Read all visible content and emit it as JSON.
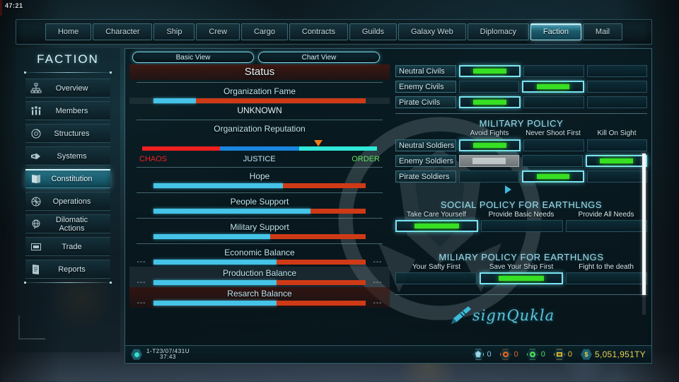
{
  "hud": {
    "top_timer": "47:21"
  },
  "topnav": {
    "tabs": [
      {
        "label": "Home",
        "active": false
      },
      {
        "label": "Character",
        "active": false
      },
      {
        "label": "Ship",
        "active": false
      },
      {
        "label": "Crew",
        "active": false
      },
      {
        "label": "Cargo",
        "active": false
      },
      {
        "label": "Contracts",
        "active": false
      },
      {
        "label": "Guilds",
        "active": false
      },
      {
        "label": "Galaxy Web",
        "active": false
      },
      {
        "label": "Diplomacy",
        "active": false
      },
      {
        "label": "Faction",
        "active": true
      },
      {
        "label": "Mail",
        "active": false
      }
    ]
  },
  "sidebar": {
    "title": "FACTION",
    "items": [
      {
        "label": "Overview",
        "icon": "org-chart-icon",
        "active": false
      },
      {
        "label": "Members",
        "icon": "people-group-icon",
        "active": false
      },
      {
        "label": "Structures",
        "icon": "structure-icon",
        "active": false
      },
      {
        "label": "Systems",
        "icon": "ship-icon",
        "active": false
      },
      {
        "label": "Constitution",
        "icon": "book-icon",
        "active": true
      },
      {
        "label": "Operations",
        "icon": "operations-icon",
        "active": false
      },
      {
        "label": "Dilomatic Actions",
        "icon": "globe-icon",
        "active": false
      },
      {
        "label": "Trade",
        "icon": "trade-icon",
        "active": false
      },
      {
        "label": "Reports",
        "icon": "report-icon",
        "active": false
      }
    ]
  },
  "panel": {
    "view_tabs": [
      {
        "label": "Basic View",
        "active": true
      },
      {
        "label": "Chart View",
        "active": false
      }
    ],
    "status": {
      "title": "Status",
      "fame": {
        "label": "Organization Fame",
        "blue_pct": 20,
        "red_pct": 80,
        "value_text": "UNKNOWN"
      },
      "reputation": {
        "label": "Organization Reputation",
        "left_label": "CHAOS",
        "mid_label": "JUSTICE",
        "right_label": "ORDER",
        "chaos_pct": 33,
        "justice_pct": 34,
        "order_pct": 33,
        "marker_pct": 75,
        "left_color": "#ef2020",
        "mid_color": "#1a86e0",
        "right_color": "#2fe8d8",
        "marker_color": "#f07a16"
      },
      "bars": [
        {
          "label": "Hope",
          "blue_pct": 61,
          "red_pct": 39,
          "left_dots": "",
          "right_dots": "",
          "band": "none"
        },
        {
          "label": "People Support",
          "blue_pct": 74,
          "red_pct": 26,
          "left_dots": "",
          "right_dots": "",
          "band": "none"
        },
        {
          "label": "Military Support",
          "blue_pct": 55,
          "red_pct": 45,
          "left_dots": "",
          "right_dots": "",
          "band": "none"
        },
        {
          "label": "Economic Balance",
          "blue_pct": 58,
          "red_pct": 42,
          "left_dots": "---",
          "right_dots": "---",
          "band": "none"
        },
        {
          "label": "Production Balance",
          "blue_pct": 58,
          "red_pct": 42,
          "left_dots": "---",
          "right_dots": "---",
          "band": "grey"
        },
        {
          "label": "Resarch Balance",
          "blue_pct": 58,
          "red_pct": 42,
          "left_dots": "---",
          "right_dots": "---",
          "band": "red"
        }
      ]
    },
    "civils": {
      "rows": [
        {
          "label": "Neutral Civils",
          "selected": 0,
          "cells": 3
        },
        {
          "label": "Enemy Civils",
          "selected": 1,
          "cells": 3
        },
        {
          "label": "Pirate Civils",
          "selected": 0,
          "cells": 3
        }
      ]
    },
    "military_policy": {
      "title": "MILITARY POLICY",
      "columns": [
        "Avoid  Fights",
        "Never Shoot First",
        "Kill On Sight"
      ],
      "rows": [
        {
          "label": "Neutral Soldiers",
          "selected": 0,
          "dimmed": -1
        },
        {
          "label": "Enemy Soldiers",
          "selected": 2,
          "dimmed": 0
        },
        {
          "label": "Pirate Soldiers",
          "selected": 1,
          "dimmed": -1
        }
      ]
    },
    "social_policy": {
      "title": "SOCIAL  POLICY FOR EARTHLNGS",
      "options": [
        "Take Care Yourself",
        "Provide Basic Needs",
        "Provide All Needs"
      ],
      "selected": 0
    },
    "military_policy_earthlings": {
      "title": "MILIARY  POLICY FOR EARTHLNGS",
      "options": [
        "Your Safty First",
        "Save Your Ship First",
        "Fight to the death"
      ],
      "selected": 1
    },
    "signature": {
      "text": "signQukla",
      "icon": "pen-icon"
    }
  },
  "statusbar": {
    "date": "1-T23/07/431U",
    "time": "37:43",
    "resources": [
      {
        "icon": "mineral-icon",
        "value": "0",
        "color": "#7ac8e8"
      },
      {
        "icon": "gear-resource-icon",
        "value": "0",
        "color": "#e06a28"
      },
      {
        "icon": "energy-icon",
        "value": "0",
        "color": "#4fe05a"
      },
      {
        "icon": "cargo-icon",
        "value": "0",
        "color": "#e8c838"
      }
    ],
    "money": "5,051,951TY"
  },
  "colors": {
    "accent": "#5fd2e8",
    "bar_blue": "#45c4e8",
    "bar_red": "#cf3a16",
    "select_green": "#37e022"
  }
}
